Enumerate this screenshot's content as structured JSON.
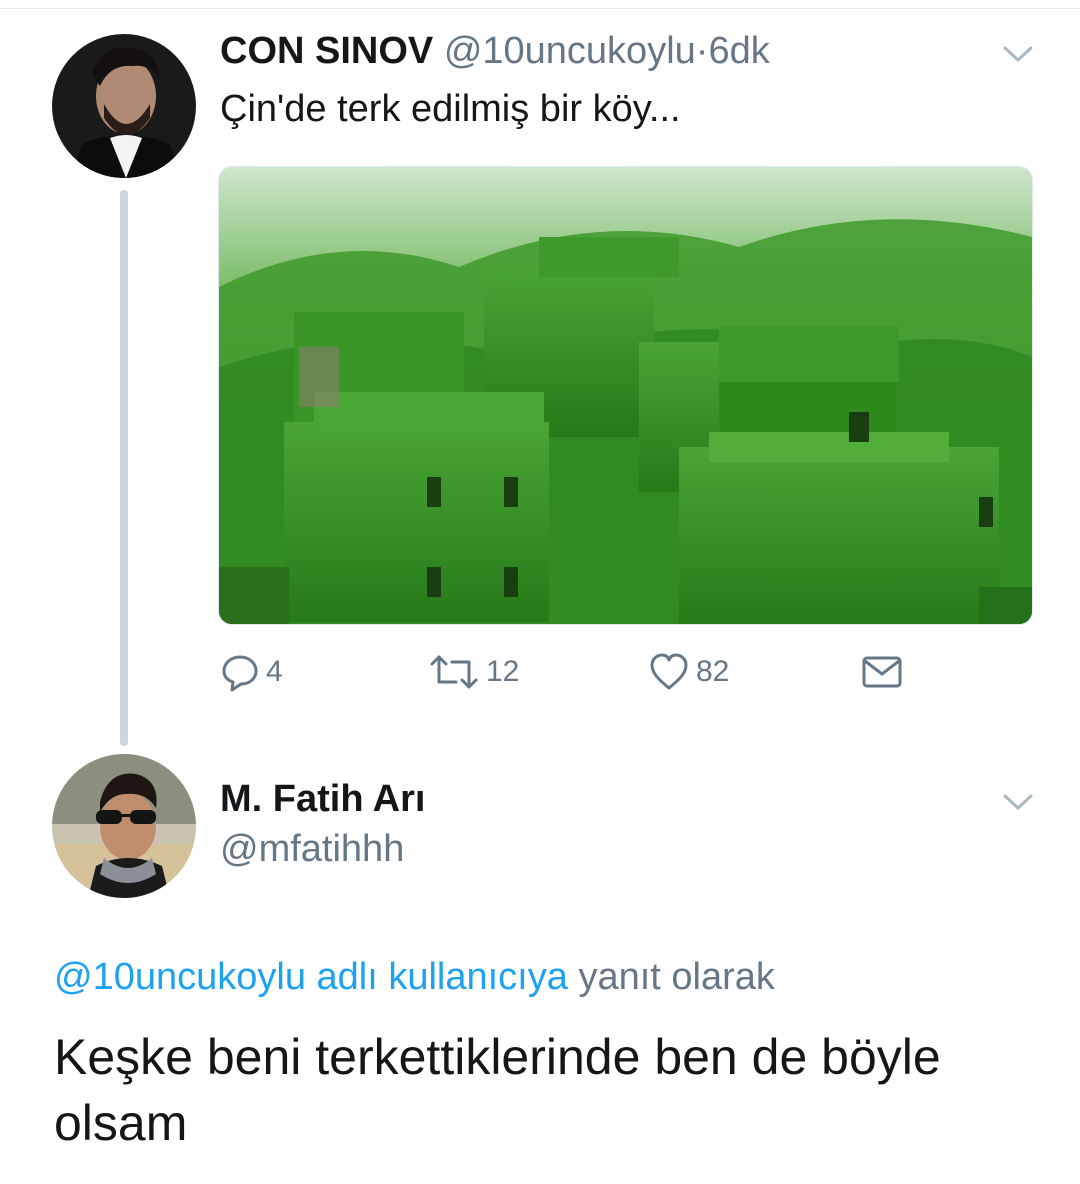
{
  "original_tweet": {
    "display_name": "CON SINOV",
    "handle": "@10uncukoylu",
    "separator": "·",
    "time": "6dk",
    "text": "Çin'de terk edilmiş bir köy...",
    "actions": {
      "reply_count": "4",
      "retweet_count": "12",
      "like_count": "82"
    }
  },
  "reply_tweet": {
    "display_name": "M. Fatih Arı",
    "handle": "@mfatihhh",
    "reply_to_link": "@10uncukoylu adlı kullanıcıya",
    "reply_to_suffix": "yanıt olarak",
    "text": "Keşke beni terkettiklerinde ben de böyle olsam"
  },
  "icons": {
    "reply": "speech-bubble-icon",
    "retweet": "retweet-icon",
    "like": "heart-icon",
    "dm": "envelope-icon",
    "menu": "chevron-down-icon"
  },
  "colors": {
    "text_primary": "#14171a",
    "text_secondary": "#657786",
    "link": "#1da1f2",
    "thread_line": "#ccd6dd"
  }
}
